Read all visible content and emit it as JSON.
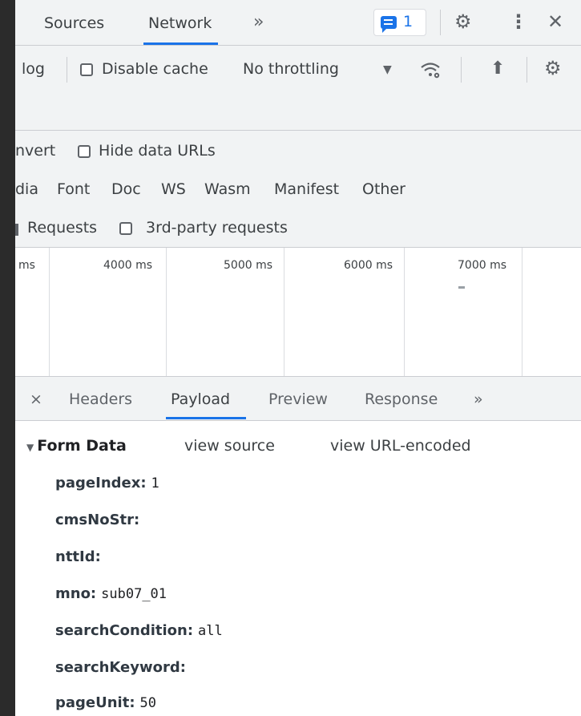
{
  "top_tabs": {
    "sources": "Sources",
    "network": "Network",
    "more": "»"
  },
  "issues_badge": {
    "count": "1"
  },
  "icons": {
    "settings": "gear-icon",
    "more_options": "kebab-icon",
    "close": "close-icon"
  },
  "toolbar": {
    "preserve_log_partial": "log",
    "disable_cache": "Disable cache",
    "throttling": "No throttling"
  },
  "filters": {
    "invert_partial": "nvert",
    "hide_data_urls": "Hide data URLs",
    "types": [
      "dia",
      "Font",
      "Doc",
      "WS",
      "Wasm",
      "Manifest",
      "Other"
    ],
    "blocked_requests_partial": "Requests",
    "third_party": "3rd-party requests"
  },
  "timeline": {
    "labels": [
      "ms",
      "4000 ms",
      "5000 ms",
      "6000 ms",
      "7000 ms"
    ]
  },
  "detail_tabs": {
    "close": "×",
    "headers": "Headers",
    "payload": "Payload",
    "preview": "Preview",
    "response": "Response",
    "more": "»"
  },
  "payload": {
    "section_title": "Form Data",
    "view_source": "view source",
    "view_url_encoded": "view URL-encoded",
    "fields": [
      {
        "key": "pageIndex:",
        "value": "1"
      },
      {
        "key": "cmsNoStr:",
        "value": ""
      },
      {
        "key": "nttId:",
        "value": ""
      },
      {
        "key": "mno:",
        "value": "sub07_01"
      },
      {
        "key": "searchCondition:",
        "value": "all"
      },
      {
        "key": "searchKeyword:",
        "value": ""
      },
      {
        "key": "pageUnit:",
        "value": "50"
      }
    ]
  },
  "colors": {
    "accent": "#1a73e8",
    "toolbar_bg": "#f1f3f4",
    "dark_bg": "#202124"
  }
}
